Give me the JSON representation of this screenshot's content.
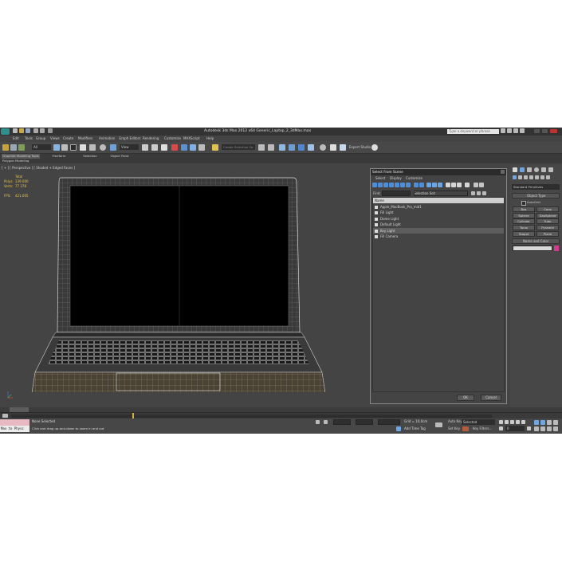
{
  "titlebar": {
    "title": "Autodesk 3ds Max 2012 x64    Generic_Laptop_2_3dMax.max",
    "search_placeholder": "Type a keyword or phrase"
  },
  "menu": [
    "Edit",
    "Tools",
    "Group",
    "Views",
    "Create",
    "Modifiers",
    "Animation",
    "Graph Editors",
    "Rendering",
    "Customize",
    "MAXScript",
    "Help"
  ],
  "toolbar": {
    "filter": "All",
    "view": "View",
    "selection_set": "Create Selection Se",
    "expert": "Expert Studio +"
  },
  "ribbon": {
    "tabs": [
      "Graphite Modeling Tools",
      "Freeform",
      "Selection",
      "Object Paint"
    ],
    "sub": "Polygon Modeling"
  },
  "viewport": {
    "label": "[ + ] [ Perspective ] [ Shaded + Edged Faces ]",
    "stats": {
      "total_label": "Total",
      "polys_label": "Polys:",
      "polys": "139 000",
      "verts_label": "Verts:",
      "verts": "77 378",
      "fps_label": "FPS:",
      "fps": "421.005"
    }
  },
  "dialog": {
    "title": "Select From Scene",
    "menu": [
      "Select",
      "Display",
      "Customize"
    ],
    "find_label": "Find:",
    "selection_set": "Selection Set:",
    "column": "Name",
    "items": [
      "Apple_MacBook_Pro_mid1",
      "Fill Light",
      "Dome Light",
      "Default Light",
      "Key Light",
      "Fill Camera"
    ],
    "ok": "OK",
    "cancel": "Cancel"
  },
  "command_panel": {
    "dropdown": "Standard Primitives",
    "object_type": "Object Type",
    "autogrid": "AutoGrid",
    "buttons": [
      "Box",
      "Cone",
      "Sphere",
      "GeoSphere",
      "Cylinder",
      "Tube",
      "Torus",
      "Pyramid",
      "Teapot",
      "Plane"
    ],
    "name_color": "Name and Color",
    "color_swatch": "#d23c8c"
  },
  "timeline": {
    "frame": "0 / 100"
  },
  "status": {
    "maxscript": "Max to Physc",
    "selected": "None Selected",
    "prompt": "Click and drag up-and-down to zoom in and out",
    "grid": "Grid = 10,0cm",
    "add_time_tag": "Add Time Tag",
    "auto_key": "Auto Key",
    "auto_key_value": "Selected",
    "set_key": "Set Key",
    "key_filters": "Key Filters...",
    "frame_field": "0"
  }
}
